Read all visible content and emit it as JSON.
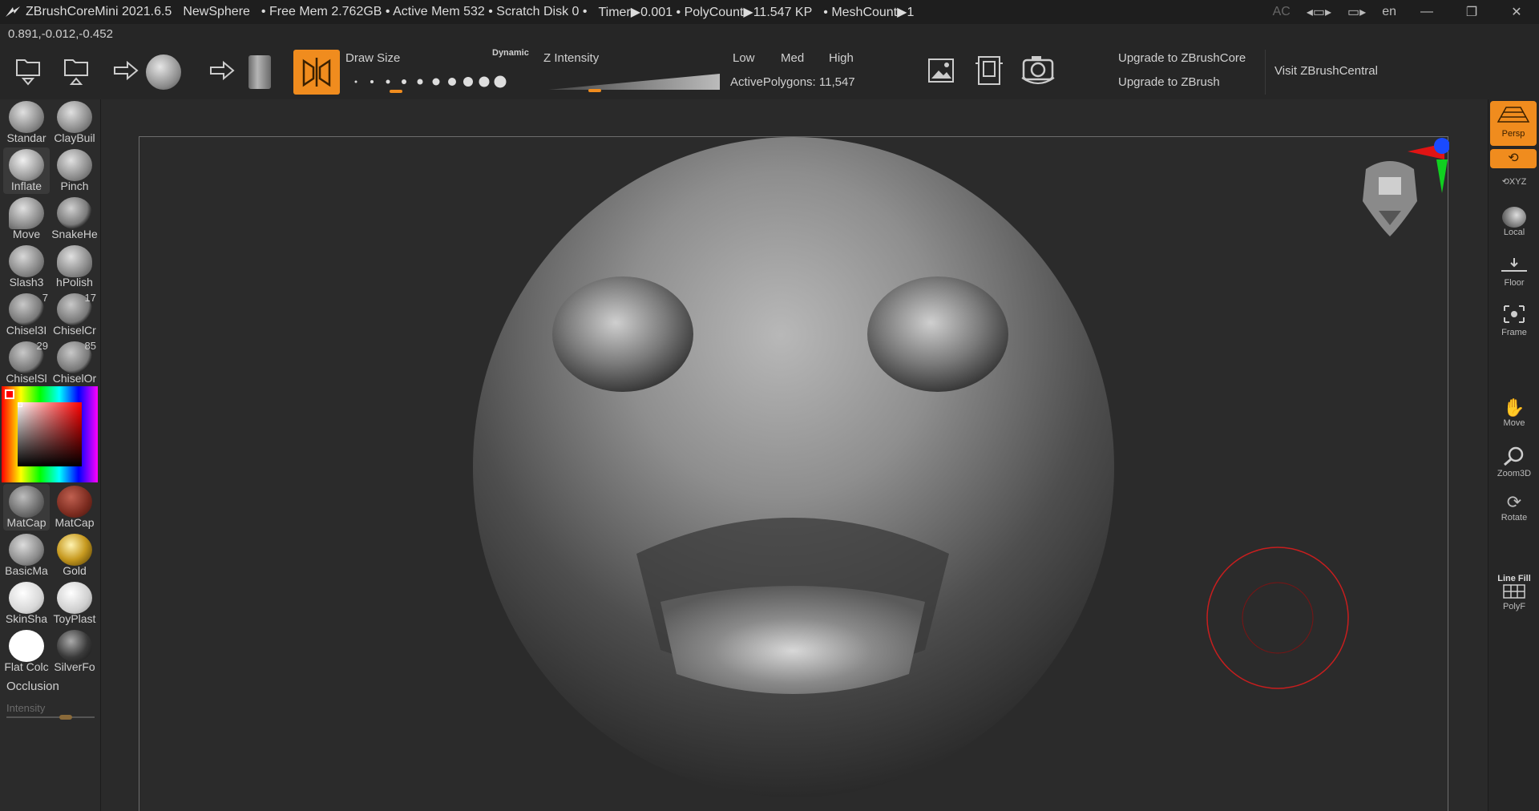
{
  "titlebar": {
    "app": "ZBrushCoreMini 2021.6.5",
    "doc": "NewSphere",
    "free_mem": "• Free Mem 2.762GB • Active Mem 532 • Scratch Disk 0 •",
    "timer": "Timer▶0.001 • PolyCount▶11.547 KP",
    "meshcount": "• MeshCount▶1",
    "ac": "AC",
    "lang": "en"
  },
  "coords": "0.891,-0.012,-0.452",
  "toolbar": {
    "draw_size": "Draw Size",
    "dynamic": "Dynamic",
    "z_intensity": "Z Intensity",
    "low": "Low",
    "med": "Med",
    "high": "High",
    "active_polygons": "ActivePolygons: 11,547",
    "upgrade_core": "Upgrade to ZBrushCore",
    "upgrade_zbrush": "Upgrade to ZBrush",
    "visit_central": "Visit ZBrushCentral",
    "draw_size_level": 0.22,
    "z_intensity_level": 0.25
  },
  "brushes": [
    {
      "label": "Standar"
    },
    {
      "label": "ClayBuil"
    },
    {
      "label": "Inflate"
    },
    {
      "label": "Pinch"
    },
    {
      "label": "Move"
    },
    {
      "label": "SnakeHe"
    },
    {
      "label": "Slash3"
    },
    {
      "label": "hPolish"
    },
    {
      "label": "Chisel3I",
      "num": "7"
    },
    {
      "label": "ChiselCr",
      "num": "17"
    },
    {
      "label": "ChiselSl",
      "num": "29"
    },
    {
      "label": "ChiselOr",
      "num": "85"
    }
  ],
  "materials": [
    {
      "label": "MatCap"
    },
    {
      "label": "MatCap"
    },
    {
      "label": "BasicMa"
    },
    {
      "label": "Gold"
    },
    {
      "label": "SkinSha"
    },
    {
      "label": "ToyPlast"
    },
    {
      "label": "Flat Colc"
    },
    {
      "label": "SilverFo"
    }
  ],
  "occlusion": "Occlusion",
  "intensity": "Intensity",
  "rightshelf": {
    "persp": "Persp",
    "xyz": "XYZ",
    "local": "Local",
    "floor": "Floor",
    "frame": "Frame",
    "move": "Move",
    "zoom3d": "Zoom3D",
    "rotate": "Rotate",
    "linefill": "Line Fill",
    "polyf": "PolyF"
  },
  "colors": {
    "accent": "#f08c1e",
    "cursor_ring": "#c81e1e"
  }
}
